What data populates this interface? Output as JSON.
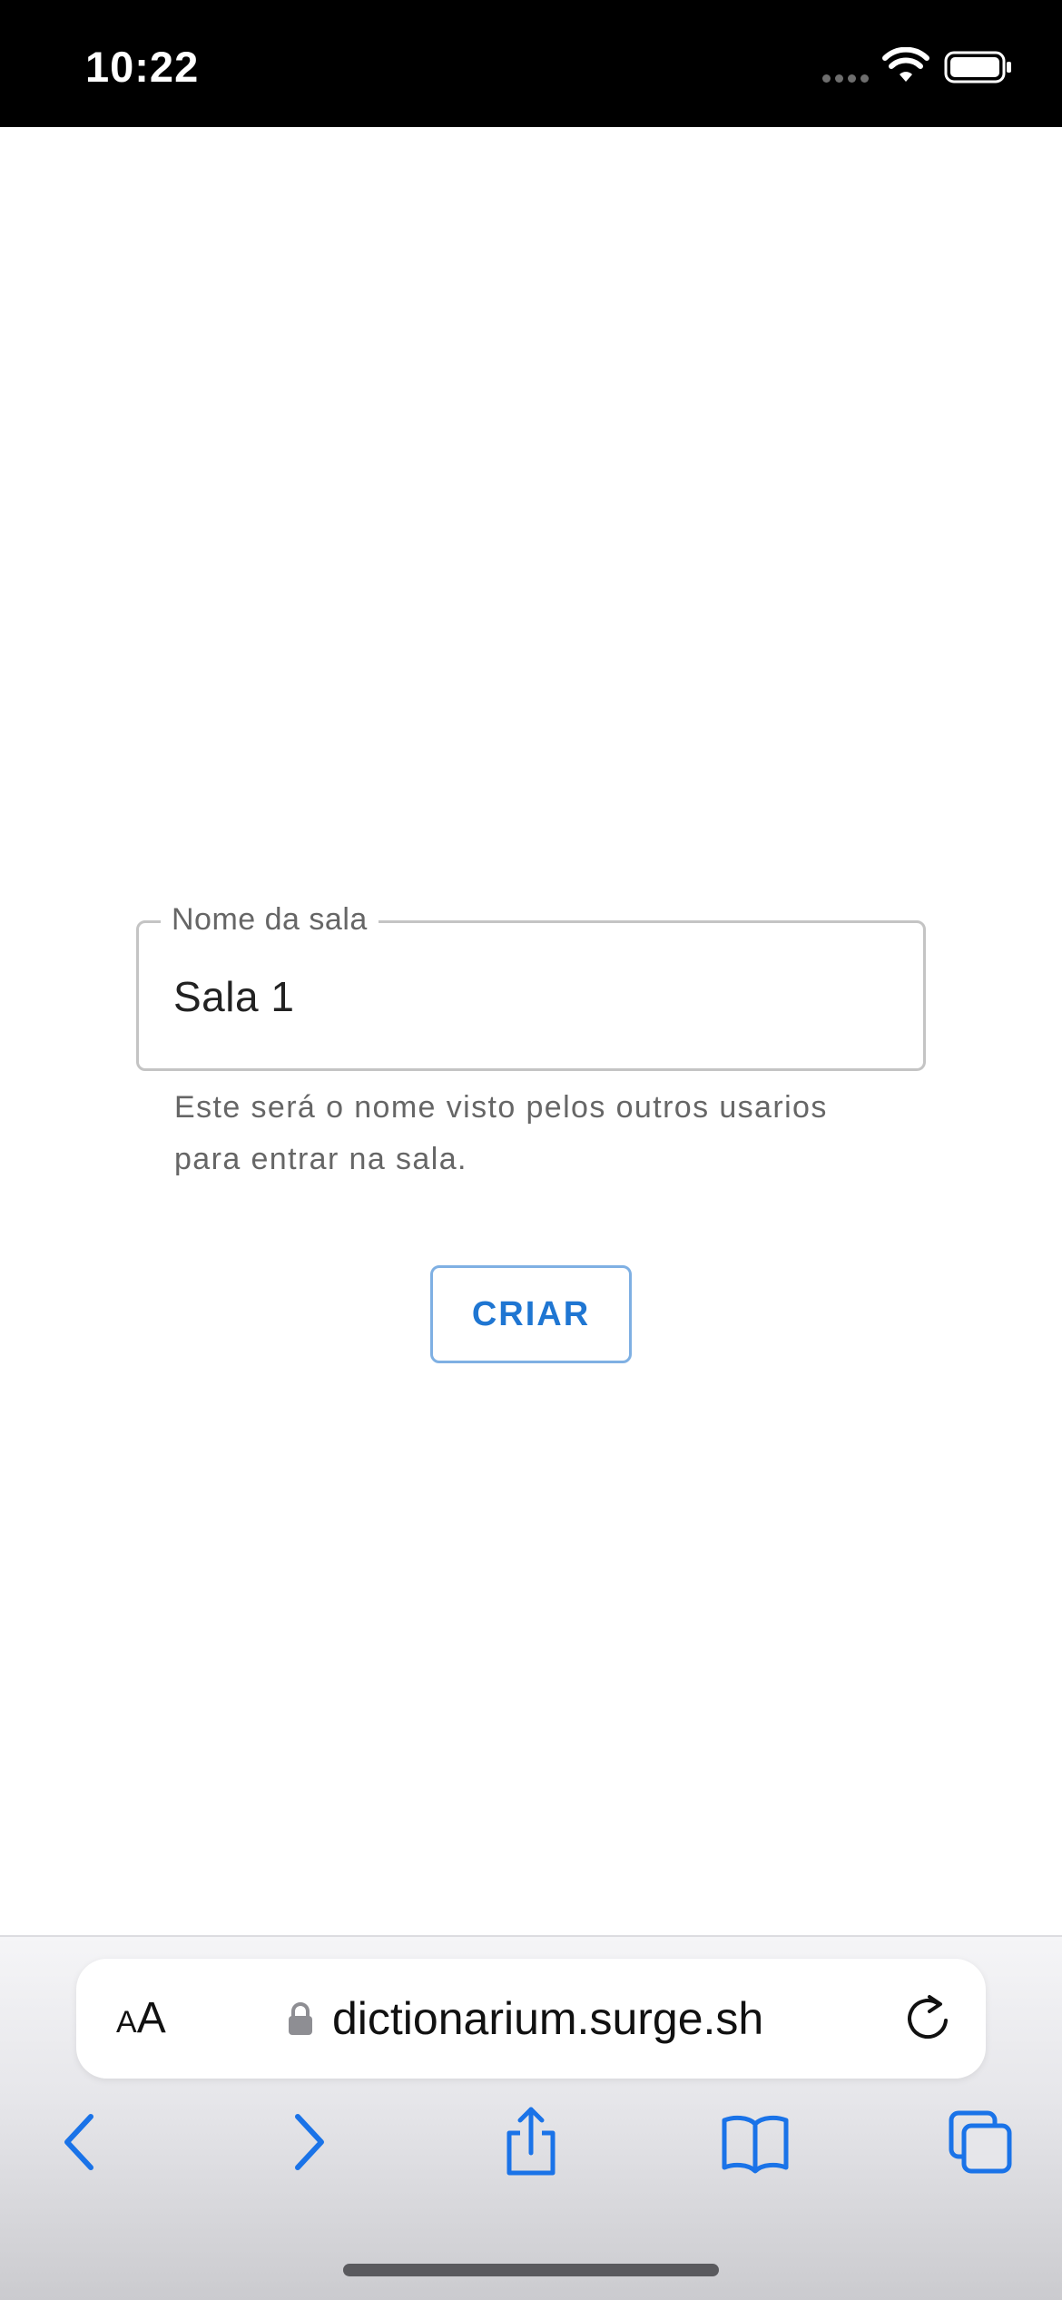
{
  "status_bar": {
    "time": "10:22"
  },
  "form": {
    "field_label": "Nome da sala",
    "field_value": "Sala 1",
    "helper_line_1": "Este será o nome visto pelos outros usarios",
    "helper_line_2": "para entrar na sala.",
    "create_button_label": "CRIAR"
  },
  "browser": {
    "text_size_small": "A",
    "text_size_large": "A",
    "url": "dictionarium.surge.sh"
  },
  "icons": {
    "wifi": "wifi-icon",
    "battery": "battery-icon",
    "lock": "lock-icon",
    "reload": "reload-icon",
    "back": "chevron-left-icon",
    "forward": "chevron-right-icon",
    "share": "share-icon",
    "bookmarks": "book-icon",
    "tabs": "tabs-icon"
  },
  "colors": {
    "accent": "#1f76d2",
    "status_bar": "#000000",
    "browser_tint": "#1a73e8"
  }
}
